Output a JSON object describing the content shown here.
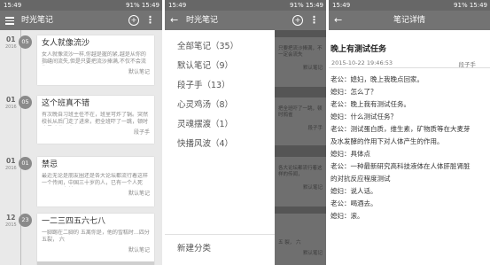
{
  "status": {
    "left": {
      "time": "15:49",
      "right": "91% 15:49"
    },
    "mid": {
      "time": "15:49",
      "right": "91% 15:49"
    },
    "right": {
      "time": "15:49",
      "right": "91% 15:49"
    }
  },
  "list_screen": {
    "title": "时光笔记",
    "entries": [
      {
        "month": "01",
        "year": "2016",
        "day": "05",
        "title": "女人就像流沙",
        "snippet": "女人就像流沙一样,你越是握的紧,越是从你的指缝间流失,但是只要把流沙捧满,不仅不会流失,",
        "category": "默认笔记"
      },
      {
        "month": "01",
        "year": "2016",
        "day": "05",
        "title": "这个班真不错",
        "snippet": "有次晚自习班主任不在，班里可炸了锅。突然校长从后门走了进来，把全班吓了一跳，顿时班里鸦雀无声了。",
        "category": "段子手"
      },
      {
        "month": "01",
        "year": "2016",
        "day": "01",
        "title": "禁忌",
        "snippet": "最近无论是朋友圈还是各大论坛都流行着这样一个传闻，中国三十岁的人，已有一个人死了，而且在某",
        "category": "默认笔记"
      },
      {
        "month": "12",
        "year": "2015",
        "day": "23",
        "title": "一二三四五六七八",
        "snippet": "一脚踢在二脚的 五离你是，他的雪糕时…四分 五裂， 六",
        "category": "默认笔记"
      }
    ]
  },
  "drawer": {
    "title": "时光笔记",
    "items": [
      "全部笔记（35）",
      "默认笔记（9）",
      "段子手（13）",
      "心灵鸡汤（8）",
      "灵魂摆渡（1）",
      "快播风波（4）"
    ],
    "new_category": "新建分类",
    "behind_snippets": [
      {
        "text": "只要把流沙捧满，不一定会流失",
        "category": "默认笔记"
      },
      {
        "text": "把全班吓了一跳，顿时鸦雀",
        "category": "段子手"
      },
      {
        "text": "各大论坛都流行着这样的传闻，",
        "category": "默认笔记"
      },
      {
        "text": "五 裂， 六",
        "category": "默认笔记"
      }
    ]
  },
  "detail": {
    "header": "笔记详情",
    "title": "晚上有测试任务",
    "time": "2015-10-22 19:46:53",
    "category": "段子手",
    "lines": [
      "老公：媳妇，晚上我晚点回家。",
      "媳妇：怎么了？",
      "老公：晚上我有测试任务。",
      "媳妇：什么测试任务？",
      "老公：测试蛋白质，维生素，矿物质等在大麦芽",
      "及水发酵的作用下对人体产生的作用。",
      "媳妇：具体点",
      "老公：一种最新研究高科技液体在人体肝脏肾脏",
      "的对抗反应程度测试",
      "媳妇：说人话。",
      "老公：喝酒去。",
      "媳妇：滚。"
    ]
  }
}
